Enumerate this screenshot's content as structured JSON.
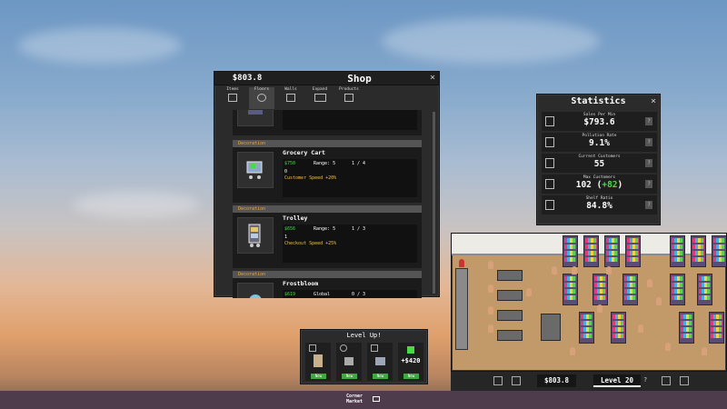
{
  "shop": {
    "money": "$803.8",
    "title": "Shop",
    "close": "×",
    "tabs": [
      {
        "label": "Items",
        "icon": "register-icon"
      },
      {
        "label": "Floors",
        "icon": "floor-icon"
      },
      {
        "label": "Walls",
        "icon": "wall-icon"
      },
      {
        "label": "Expand",
        "icon": "expand-icon"
      },
      {
        "label": "Products",
        "icon": "products-icon"
      }
    ],
    "items": [
      {
        "category": "Decoration",
        "name": "Grocery Cart",
        "price": "$750",
        "range": "Range: 5",
        "count": "1 / 4",
        "owned": "0",
        "bonus": "Customer Speed +20%",
        "icon": "grocery-cart-icon"
      },
      {
        "category": "Decoration",
        "name": "Trolley",
        "price": "$656",
        "range": "Range: 5",
        "count": "1 / 3",
        "owned": "1",
        "bonus": "Checkout Speed +25%",
        "icon": "trolley-icon"
      },
      {
        "category": "Decoration",
        "name": "Frostbloom",
        "price": "$619",
        "range": "Global",
        "count": "0 / 3",
        "owned": "",
        "bonus": "",
        "icon": "plant-icon"
      }
    ]
  },
  "stats": {
    "title": "Statistics",
    "close": "×",
    "rows": [
      {
        "label": "Sales Per Min",
        "value": "$793.6",
        "icon": "sales-icon"
      },
      {
        "label": "Pollution Rate",
        "value": "9.1%",
        "icon": "trash-icon"
      },
      {
        "label": "Current Customers",
        "value": "55",
        "icon": "customer-icon"
      },
      {
        "label": "Max Customers",
        "value": "102 (",
        "value_extra": "+82",
        "value_end": ")",
        "icon": "max-customers-icon"
      },
      {
        "label": "Shelf Ratio",
        "value": "84.8%",
        "icon": "shelf-icon"
      }
    ],
    "help": "?"
  },
  "levelup": {
    "title": "Level Up!",
    "slots": [
      {
        "badge": "New",
        "icon": "fridge-icon"
      },
      {
        "badge": "New",
        "icon": "floor-tile-icon"
      },
      {
        "badge": "New",
        "icon": "basket-icon"
      },
      {
        "badge": "New",
        "icon": "money-icon",
        "amount": "+$420"
      }
    ]
  },
  "storebar": {
    "cash": "$803.8",
    "level": "Level 20",
    "help": "?"
  },
  "taskbar": {
    "logo_line1": "Corner",
    "logo_line2": "Market"
  }
}
